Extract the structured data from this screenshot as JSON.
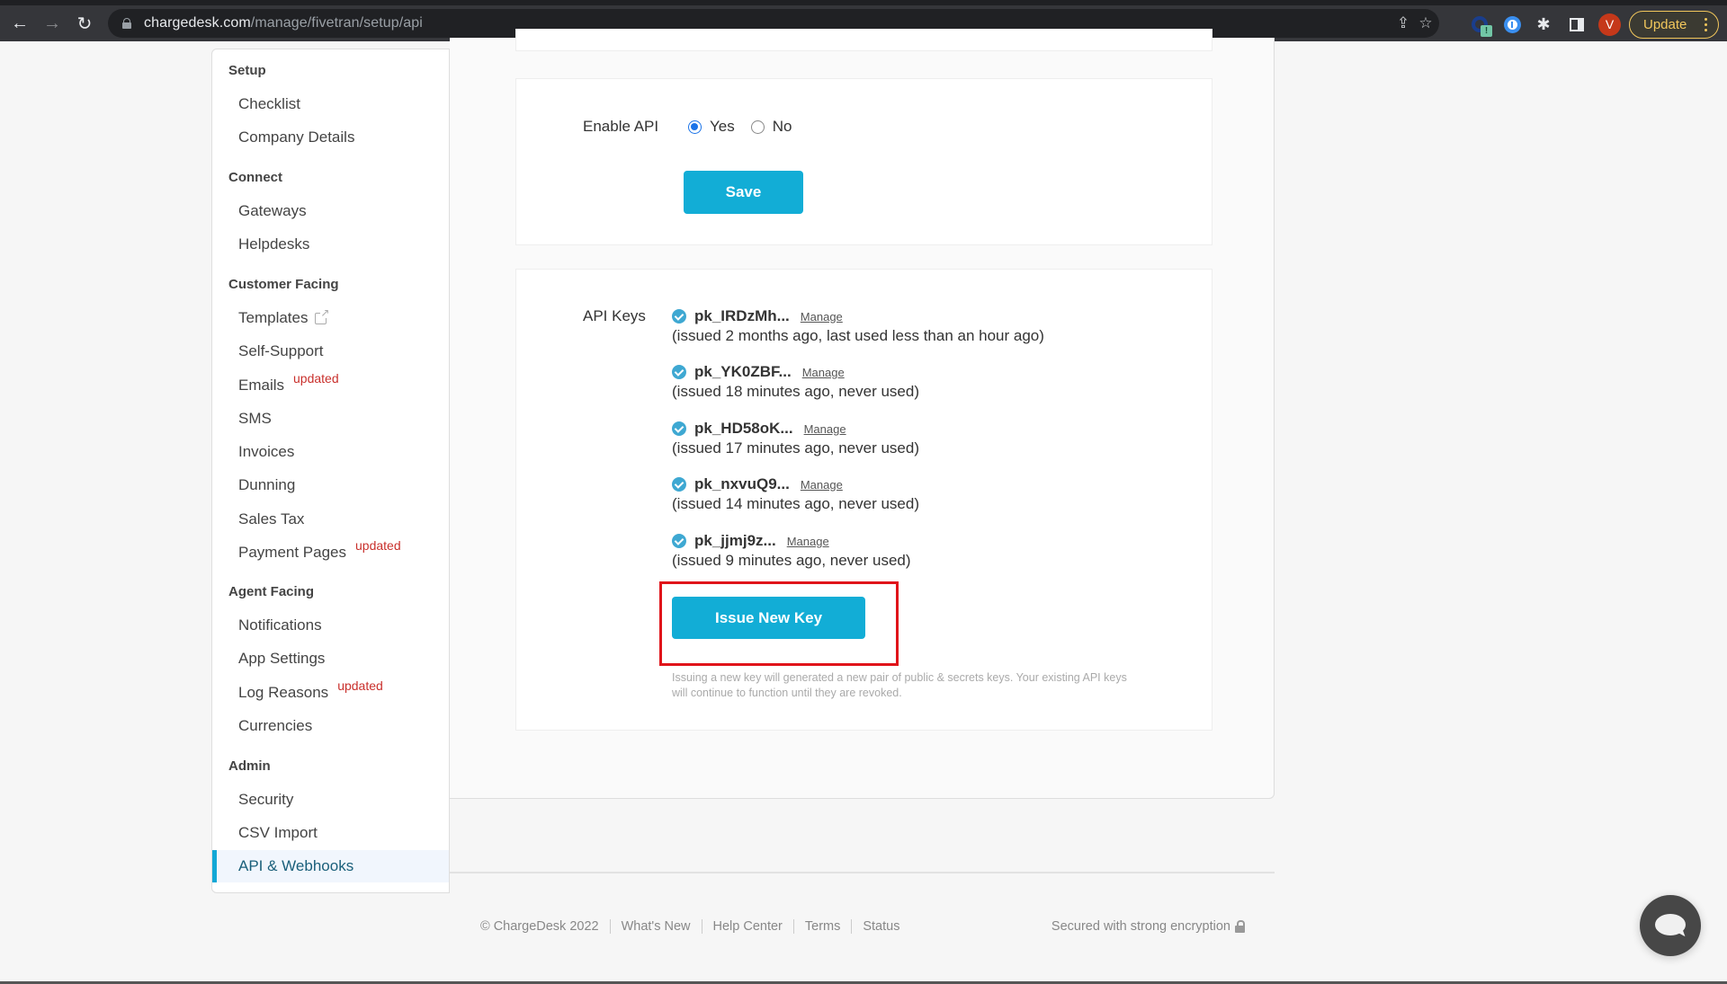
{
  "browser": {
    "url_host": "chargedesk.com",
    "url_path": "/manage/fivetran/setup/api",
    "avatar_letter": "V",
    "update_label": "Update",
    "icons": [
      "back-arrow-icon",
      "forward-arrow-icon",
      "reload-icon",
      "lock-icon",
      "share-icon",
      "star-icon",
      "extension-icon",
      "password-manager-icon",
      "puzzle-icon",
      "sidepanel-icon",
      "menu-dots-icon"
    ],
    "ext_badge": "!"
  },
  "sidebar": {
    "sections": [
      {
        "heading": "Setup",
        "items": [
          {
            "label": "Checklist"
          },
          {
            "label": "Company Details"
          }
        ]
      },
      {
        "heading": "Connect",
        "items": [
          {
            "label": "Gateways"
          },
          {
            "label": "Helpdesks"
          }
        ]
      },
      {
        "heading": "Customer Facing",
        "items": [
          {
            "label": "Templates",
            "external": true
          },
          {
            "label": "Self-Support"
          },
          {
            "label": "Emails",
            "badge": "updated"
          },
          {
            "label": "SMS"
          },
          {
            "label": "Invoices"
          },
          {
            "label": "Dunning"
          },
          {
            "label": "Sales Tax"
          },
          {
            "label": "Payment Pages",
            "badge": "updated"
          }
        ]
      },
      {
        "heading": "Agent Facing",
        "items": [
          {
            "label": "Notifications"
          },
          {
            "label": "App Settings"
          },
          {
            "label": "Log Reasons",
            "badge": "updated"
          },
          {
            "label": "Currencies"
          }
        ]
      },
      {
        "heading": "Admin",
        "items": [
          {
            "label": "Security"
          },
          {
            "label": "CSV Import"
          },
          {
            "label": "API & Webhooks",
            "active": true
          }
        ]
      }
    ]
  },
  "enable_api": {
    "label": "Enable API",
    "options": [
      {
        "label": "Yes",
        "checked": true
      },
      {
        "label": "No",
        "checked": false
      }
    ],
    "save_label": "Save"
  },
  "api_keys": {
    "label": "API Keys",
    "keys": [
      {
        "id": "pk_IRDzMh...",
        "manage": "Manage",
        "meta": "(issued 2 months ago, last used less than an hour ago)"
      },
      {
        "id": "pk_YK0ZBF...",
        "manage": "Manage",
        "meta": "(issued 18 minutes ago, never used)"
      },
      {
        "id": "pk_HD58oK...",
        "manage": "Manage",
        "meta": "(issued 17 minutes ago, never used)"
      },
      {
        "id": "pk_nxvuQ9...",
        "manage": "Manage",
        "meta": "(issued 14 minutes ago, never used)"
      },
      {
        "id": "pk_jjmj9z...",
        "manage": "Manage",
        "meta": "(issued 9 minutes ago, never used)"
      }
    ],
    "issue_label": "Issue New Key",
    "hint": "Issuing a new key will generated a new pair of public & secrets keys. Your existing API keys will continue to function until they are revoked."
  },
  "footer": {
    "copyright": "© ChargeDesk 2022",
    "links": [
      "What's New",
      "Help Center",
      "Terms",
      "Status"
    ],
    "secure": "Secured with strong encryption"
  },
  "colors": {
    "accent": "#12add6",
    "updated_badge": "#c9302c",
    "highlight_box": "#e0141a",
    "active_nav": "#1a5f7a"
  }
}
